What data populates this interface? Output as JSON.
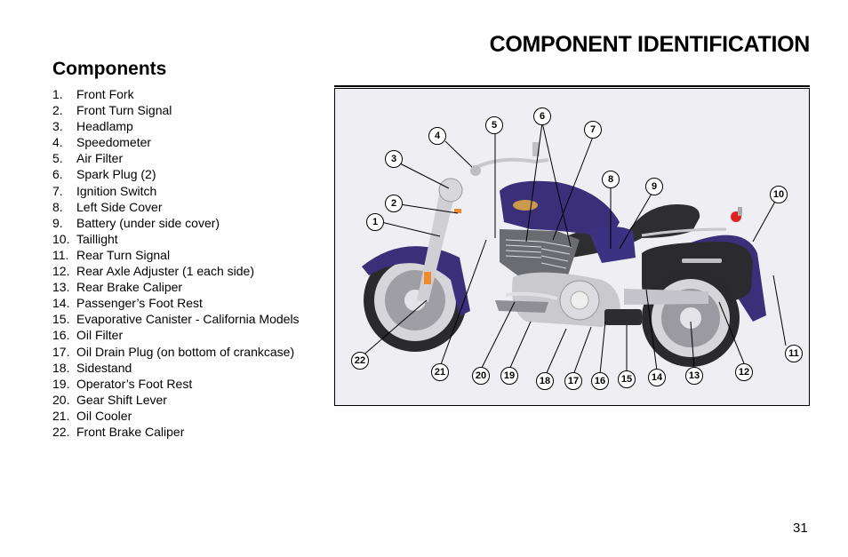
{
  "header": {
    "title": "COMPONENT IDENTIFICATION"
  },
  "section": {
    "title": "Components"
  },
  "components": [
    {
      "num": "1.",
      "label": "Front Fork"
    },
    {
      "num": "2.",
      "label": "Front Turn Signal"
    },
    {
      "num": "3.",
      "label": "Headlamp"
    },
    {
      "num": "4.",
      "label": "Speedometer"
    },
    {
      "num": "5.",
      "label": "Air Filter"
    },
    {
      "num": "6.",
      "label": "Spark Plug (2)"
    },
    {
      "num": "7.",
      "label": "Ignition Switch"
    },
    {
      "num": "8.",
      "label": "Left Side Cover"
    },
    {
      "num": "9.",
      "label": "Battery (under side cover)"
    },
    {
      "num": "10.",
      "label": "Taillight"
    },
    {
      "num": "11.",
      "label": "Rear Turn Signal"
    },
    {
      "num": "12.",
      "label": "Rear Axle Adjuster (1 each side)"
    },
    {
      "num": "13.",
      "label": "Rear Brake Caliper"
    },
    {
      "num": "14.",
      "label": "Passenger’s Foot Rest"
    },
    {
      "num": "15.",
      "label": "Evaporative Canister - California Models"
    },
    {
      "num": "16.",
      "label": "Oil Filter"
    },
    {
      "num": "17.",
      "label": "Oil Drain Plug (on bottom of crankcase)"
    },
    {
      "num": "18.",
      "label": "Sidestand"
    },
    {
      "num": "19.",
      "label": "Operator’s Foot Rest"
    },
    {
      "num": "20.",
      "label": "Gear Shift Lever"
    },
    {
      "num": "21.",
      "label": "Oil Cooler"
    },
    {
      "num": "22.",
      "label": "Front Brake Caliper"
    }
  ],
  "figure": {
    "description": "Motorcycle left side view with numbered component callouts",
    "callouts": [
      "1",
      "2",
      "3",
      "4",
      "5",
      "6",
      "7",
      "8",
      "9",
      "10",
      "11",
      "12",
      "13",
      "14",
      "15",
      "16",
      "17",
      "18",
      "19",
      "20",
      "21",
      "22"
    ],
    "colors": {
      "background": "#efeef2",
      "body_paint": "#3b2f7a",
      "chrome": "#c8c8cc",
      "tire": "#2a2a2e",
      "seat": "#2e2e30"
    }
  },
  "footer": {
    "page_number": "31"
  }
}
